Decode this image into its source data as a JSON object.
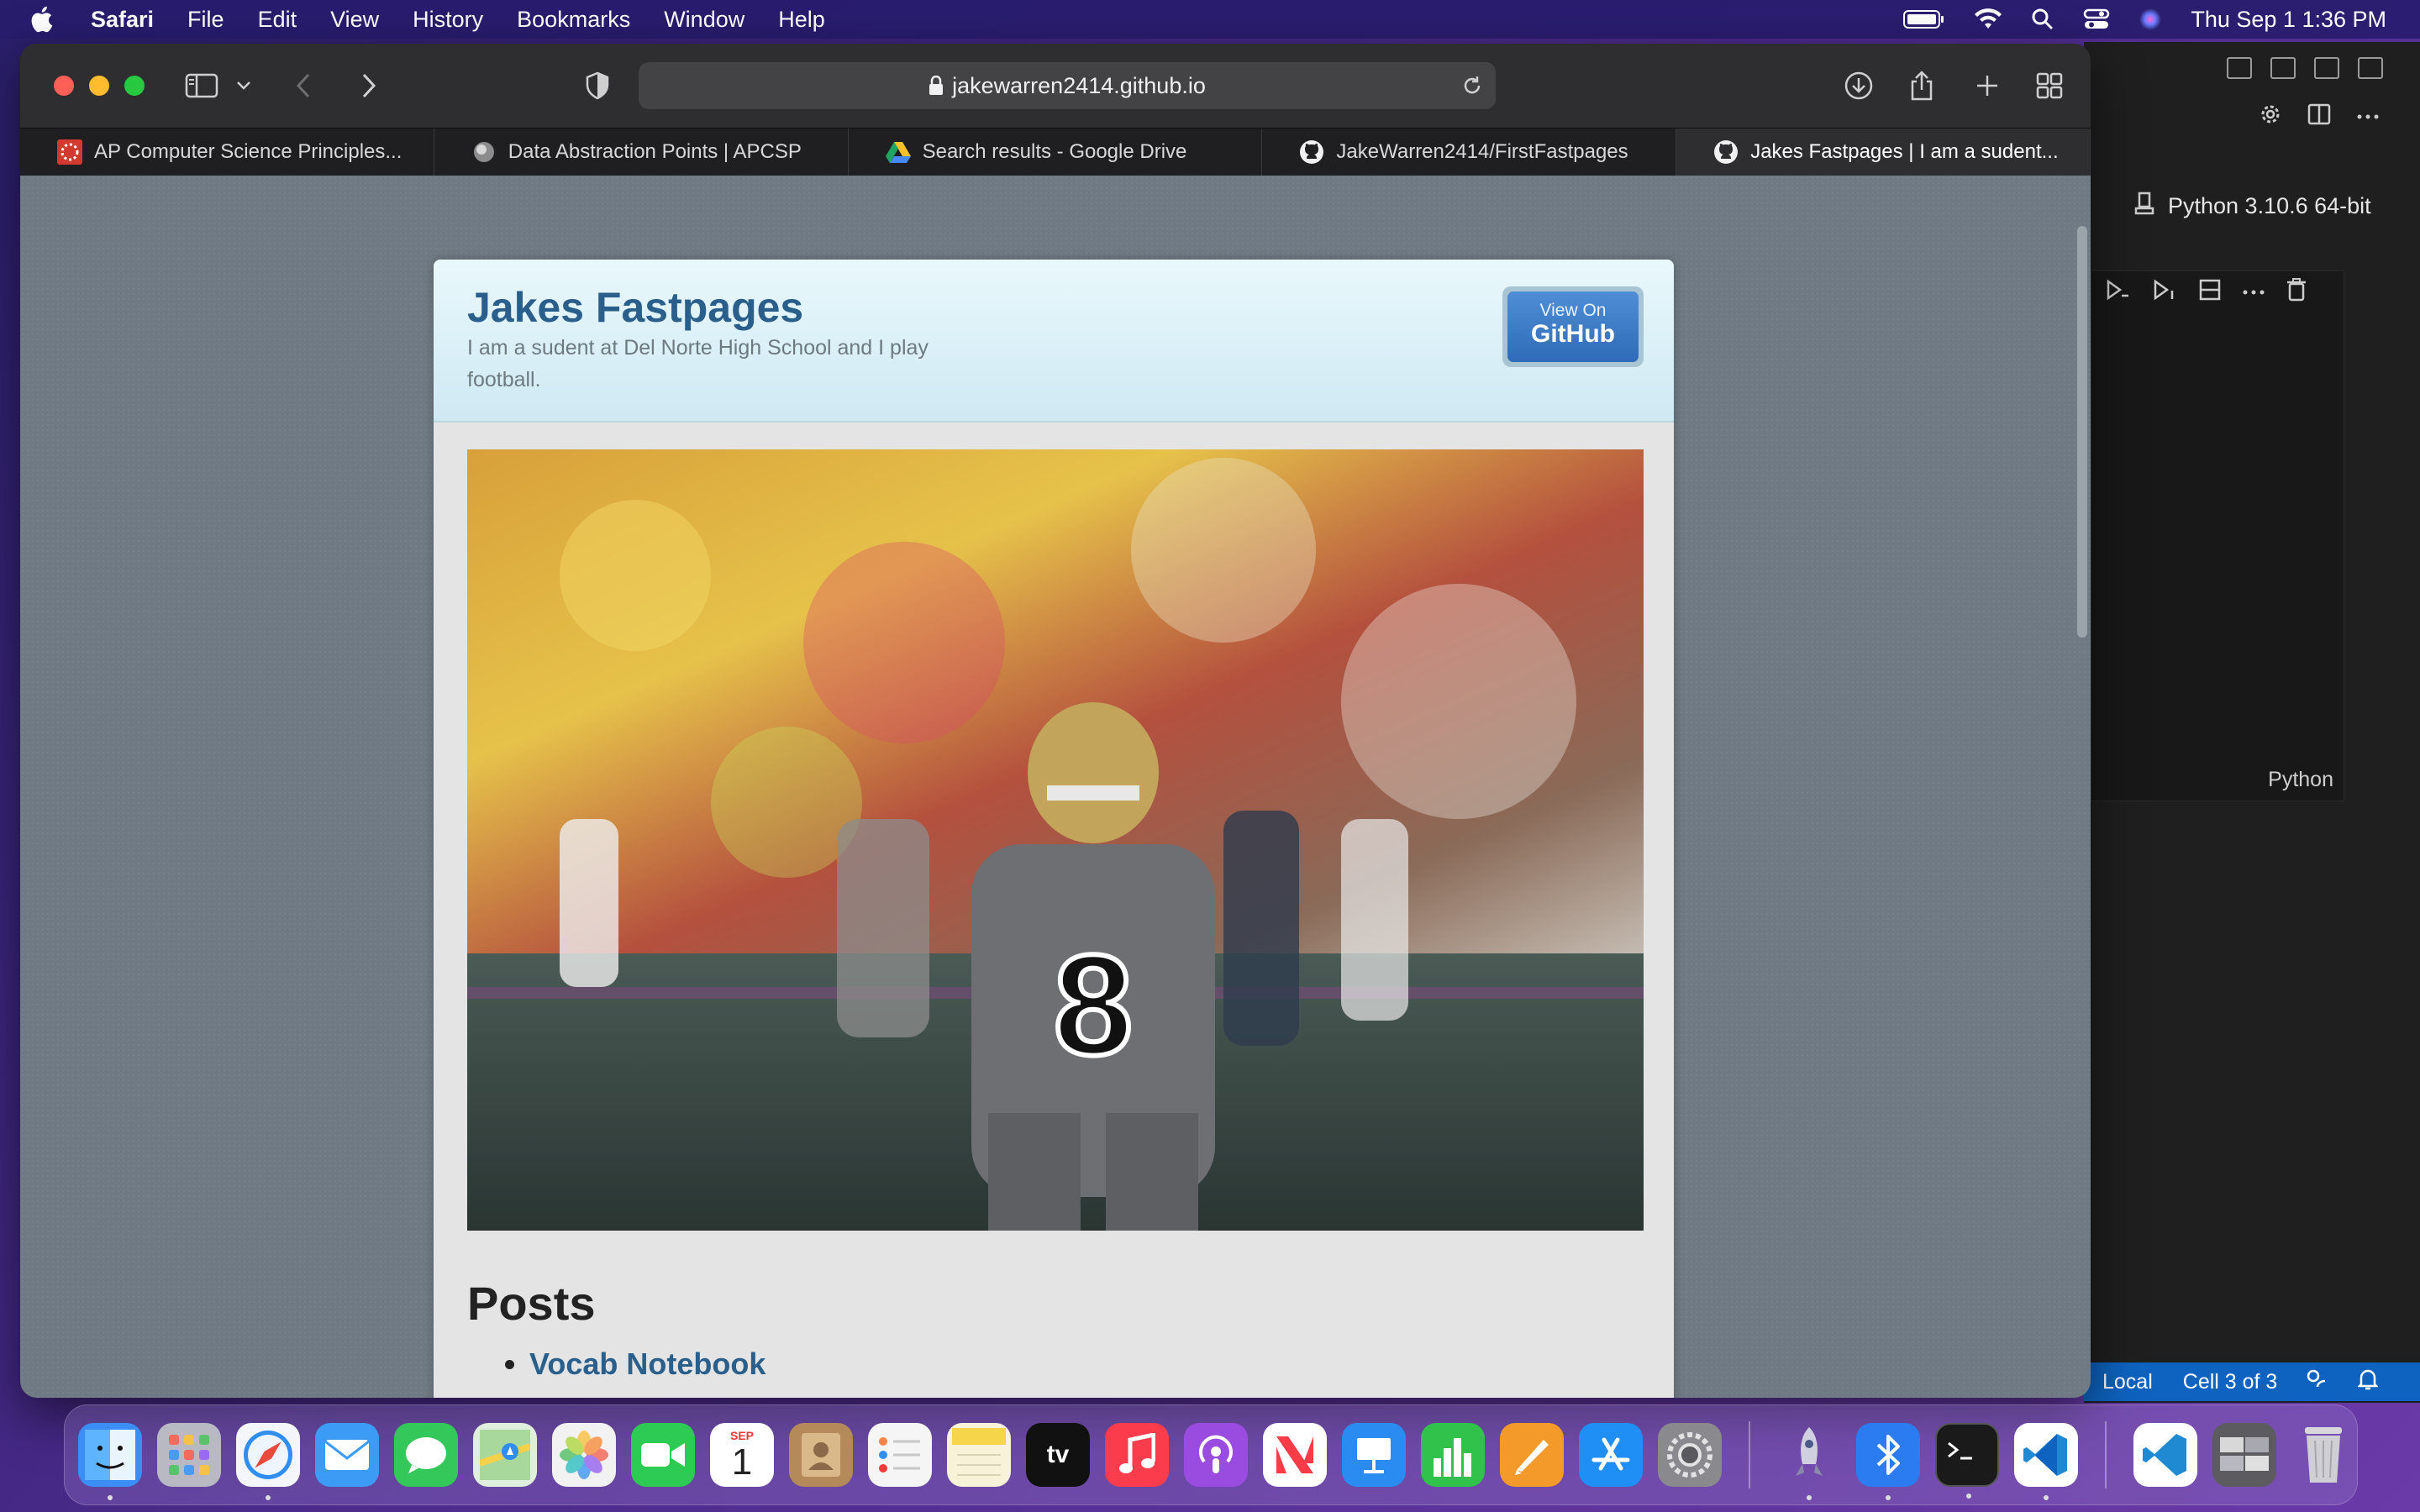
{
  "menubar": {
    "app": "Safari",
    "items": [
      "File",
      "Edit",
      "View",
      "History",
      "Bookmarks",
      "Window",
      "Help"
    ],
    "clock": "Thu Sep 1  1:36 PM"
  },
  "safari": {
    "address": "jakewarren2414.github.io",
    "tabs": [
      {
        "label": "AP Computer Science Principles...",
        "icon": "red-mosaic-icon"
      },
      {
        "label": "Data Abstraction Points | APCSP",
        "icon": "globe-icon"
      },
      {
        "label": "Search results - Google Drive",
        "icon": "google-drive-icon"
      },
      {
        "label": "JakeWarren2414/FirstFastpages",
        "icon": "github-icon"
      },
      {
        "label": "Jakes Fastpages | I am a sudent...",
        "icon": "github-icon"
      }
    ],
    "active_tab_index": 4
  },
  "page": {
    "title": "Jakes Fastpages",
    "description": "I am a sudent at Del Norte High School and I play football.",
    "github_button": {
      "small": "View On",
      "big": "GitHub"
    },
    "hero_image": "football player number 8 on field",
    "posts_heading": "Posts",
    "posts": [
      "Vocab Notebook"
    ]
  },
  "vscode": {
    "kernel": "Python 3.10.6 64-bit",
    "cell_language": "Python",
    "status_left": "Local",
    "status_cell": "Cell 3 of 3"
  },
  "dock": {
    "apps": [
      {
        "name": "finder",
        "color": "#3a8ef6",
        "running": true
      },
      {
        "name": "launchpad",
        "color": "#b9b9c4",
        "running": false
      },
      {
        "name": "safari",
        "color": "#2f8ef0",
        "running": true
      },
      {
        "name": "mail",
        "color": "#3c9bf5",
        "running": false
      },
      {
        "name": "messages",
        "color": "#34c759",
        "running": false
      },
      {
        "name": "maps",
        "color": "#5fbf6a",
        "running": false
      },
      {
        "name": "photos",
        "color": "#f2f2f2",
        "running": false
      },
      {
        "name": "facetime",
        "color": "#2ecb54",
        "running": false
      },
      {
        "name": "calendar",
        "color": "#ffffff",
        "running": false
      },
      {
        "name": "contacts",
        "color": "#b48a5a",
        "running": false
      },
      {
        "name": "reminders",
        "color": "#f5f5f5",
        "running": false
      },
      {
        "name": "notes",
        "color": "#f7d54a",
        "running": false
      },
      {
        "name": "tv",
        "color": "#111111",
        "running": false
      },
      {
        "name": "music",
        "color": "#fa3c4c",
        "running": false
      },
      {
        "name": "podcasts",
        "color": "#9b4ce0",
        "running": false
      },
      {
        "name": "news",
        "color": "#ff3b47",
        "running": false
      },
      {
        "name": "keynote",
        "color": "#2a8cf0",
        "running": false
      },
      {
        "name": "numbers",
        "color": "#30c24a",
        "running": false
      },
      {
        "name": "pages",
        "color": "#f39a2a",
        "running": false
      },
      {
        "name": "app-store",
        "color": "#1f8ef5",
        "running": false
      },
      {
        "name": "system-preferences",
        "color": "#8a8a8e",
        "running": false
      }
    ],
    "apps_right": [
      {
        "name": "rocket-typist",
        "color": "#6e6e8a",
        "running": true
      },
      {
        "name": "bluetooth",
        "color": "#2a7cf0",
        "running": true
      },
      {
        "name": "terminal",
        "color": "#1a1a1a",
        "running": true
      },
      {
        "name": "vscode",
        "color": "#1f8ad2",
        "running": true
      }
    ],
    "apps_far_right": [
      {
        "name": "vscode-downloads",
        "color": "#1f8ad2",
        "running": false
      },
      {
        "name": "screenshots",
        "color": "#5b5b60",
        "running": false
      },
      {
        "name": "trash",
        "color": "#cfcfd4",
        "running": false
      }
    ],
    "calendar_month": "SEP",
    "calendar_day": "1",
    "tv_label": "tv"
  }
}
